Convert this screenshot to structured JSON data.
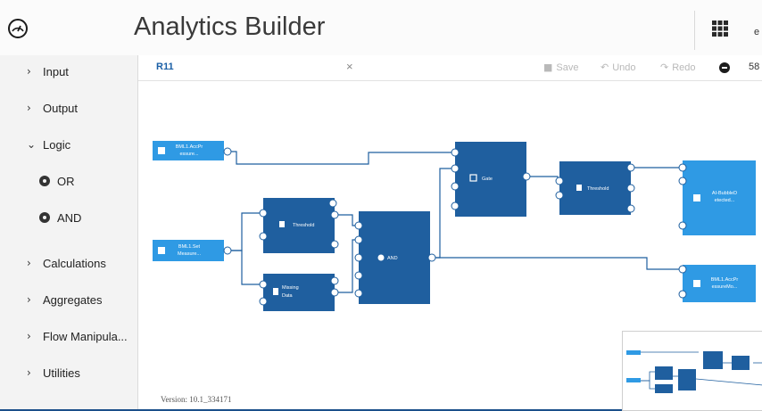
{
  "header": {
    "title": "Analytics Builder",
    "user_initial": "e"
  },
  "sidebar": {
    "items": [
      {
        "label": "Input",
        "state": "collapsed"
      },
      {
        "label": "Output",
        "state": "collapsed"
      },
      {
        "label": "Logic",
        "state": "expanded"
      },
      {
        "label": "OR",
        "type": "block"
      },
      {
        "label": "AND",
        "type": "block"
      },
      {
        "label": "Calculations",
        "state": "collapsed"
      },
      {
        "label": "Aggregates",
        "state": "collapsed"
      },
      {
        "label": "Flow Manipula...",
        "state": "collapsed"
      },
      {
        "label": "Utilities",
        "state": "collapsed"
      }
    ]
  },
  "tabbar": {
    "model_name": "R11",
    "close": "×",
    "save": "Save",
    "undo": "Undo",
    "redo": "Redo",
    "zoom": "58"
  },
  "canvas": {
    "version": "Version: 10.1_334171",
    "blocks": {
      "input1": [
        "BML1.AccPr",
        "essure..."
      ],
      "input2": [
        "BML1.Set",
        "Measure..."
      ],
      "threshold1": "Threshold",
      "missing": [
        "Missing",
        "Data"
      ],
      "and": "AND",
      "gate": "Gate",
      "threshold2": "Threshold",
      "out1": [
        "AI-BubbleD",
        "etected..."
      ],
      "out2": [
        "BML1.AccPr",
        "essureMo..."
      ]
    }
  },
  "colors": {
    "brand": "#1b4f8a",
    "block": "#1f5f9f",
    "io_block": "#2f9ae4",
    "wire": "#1f5f9f"
  }
}
